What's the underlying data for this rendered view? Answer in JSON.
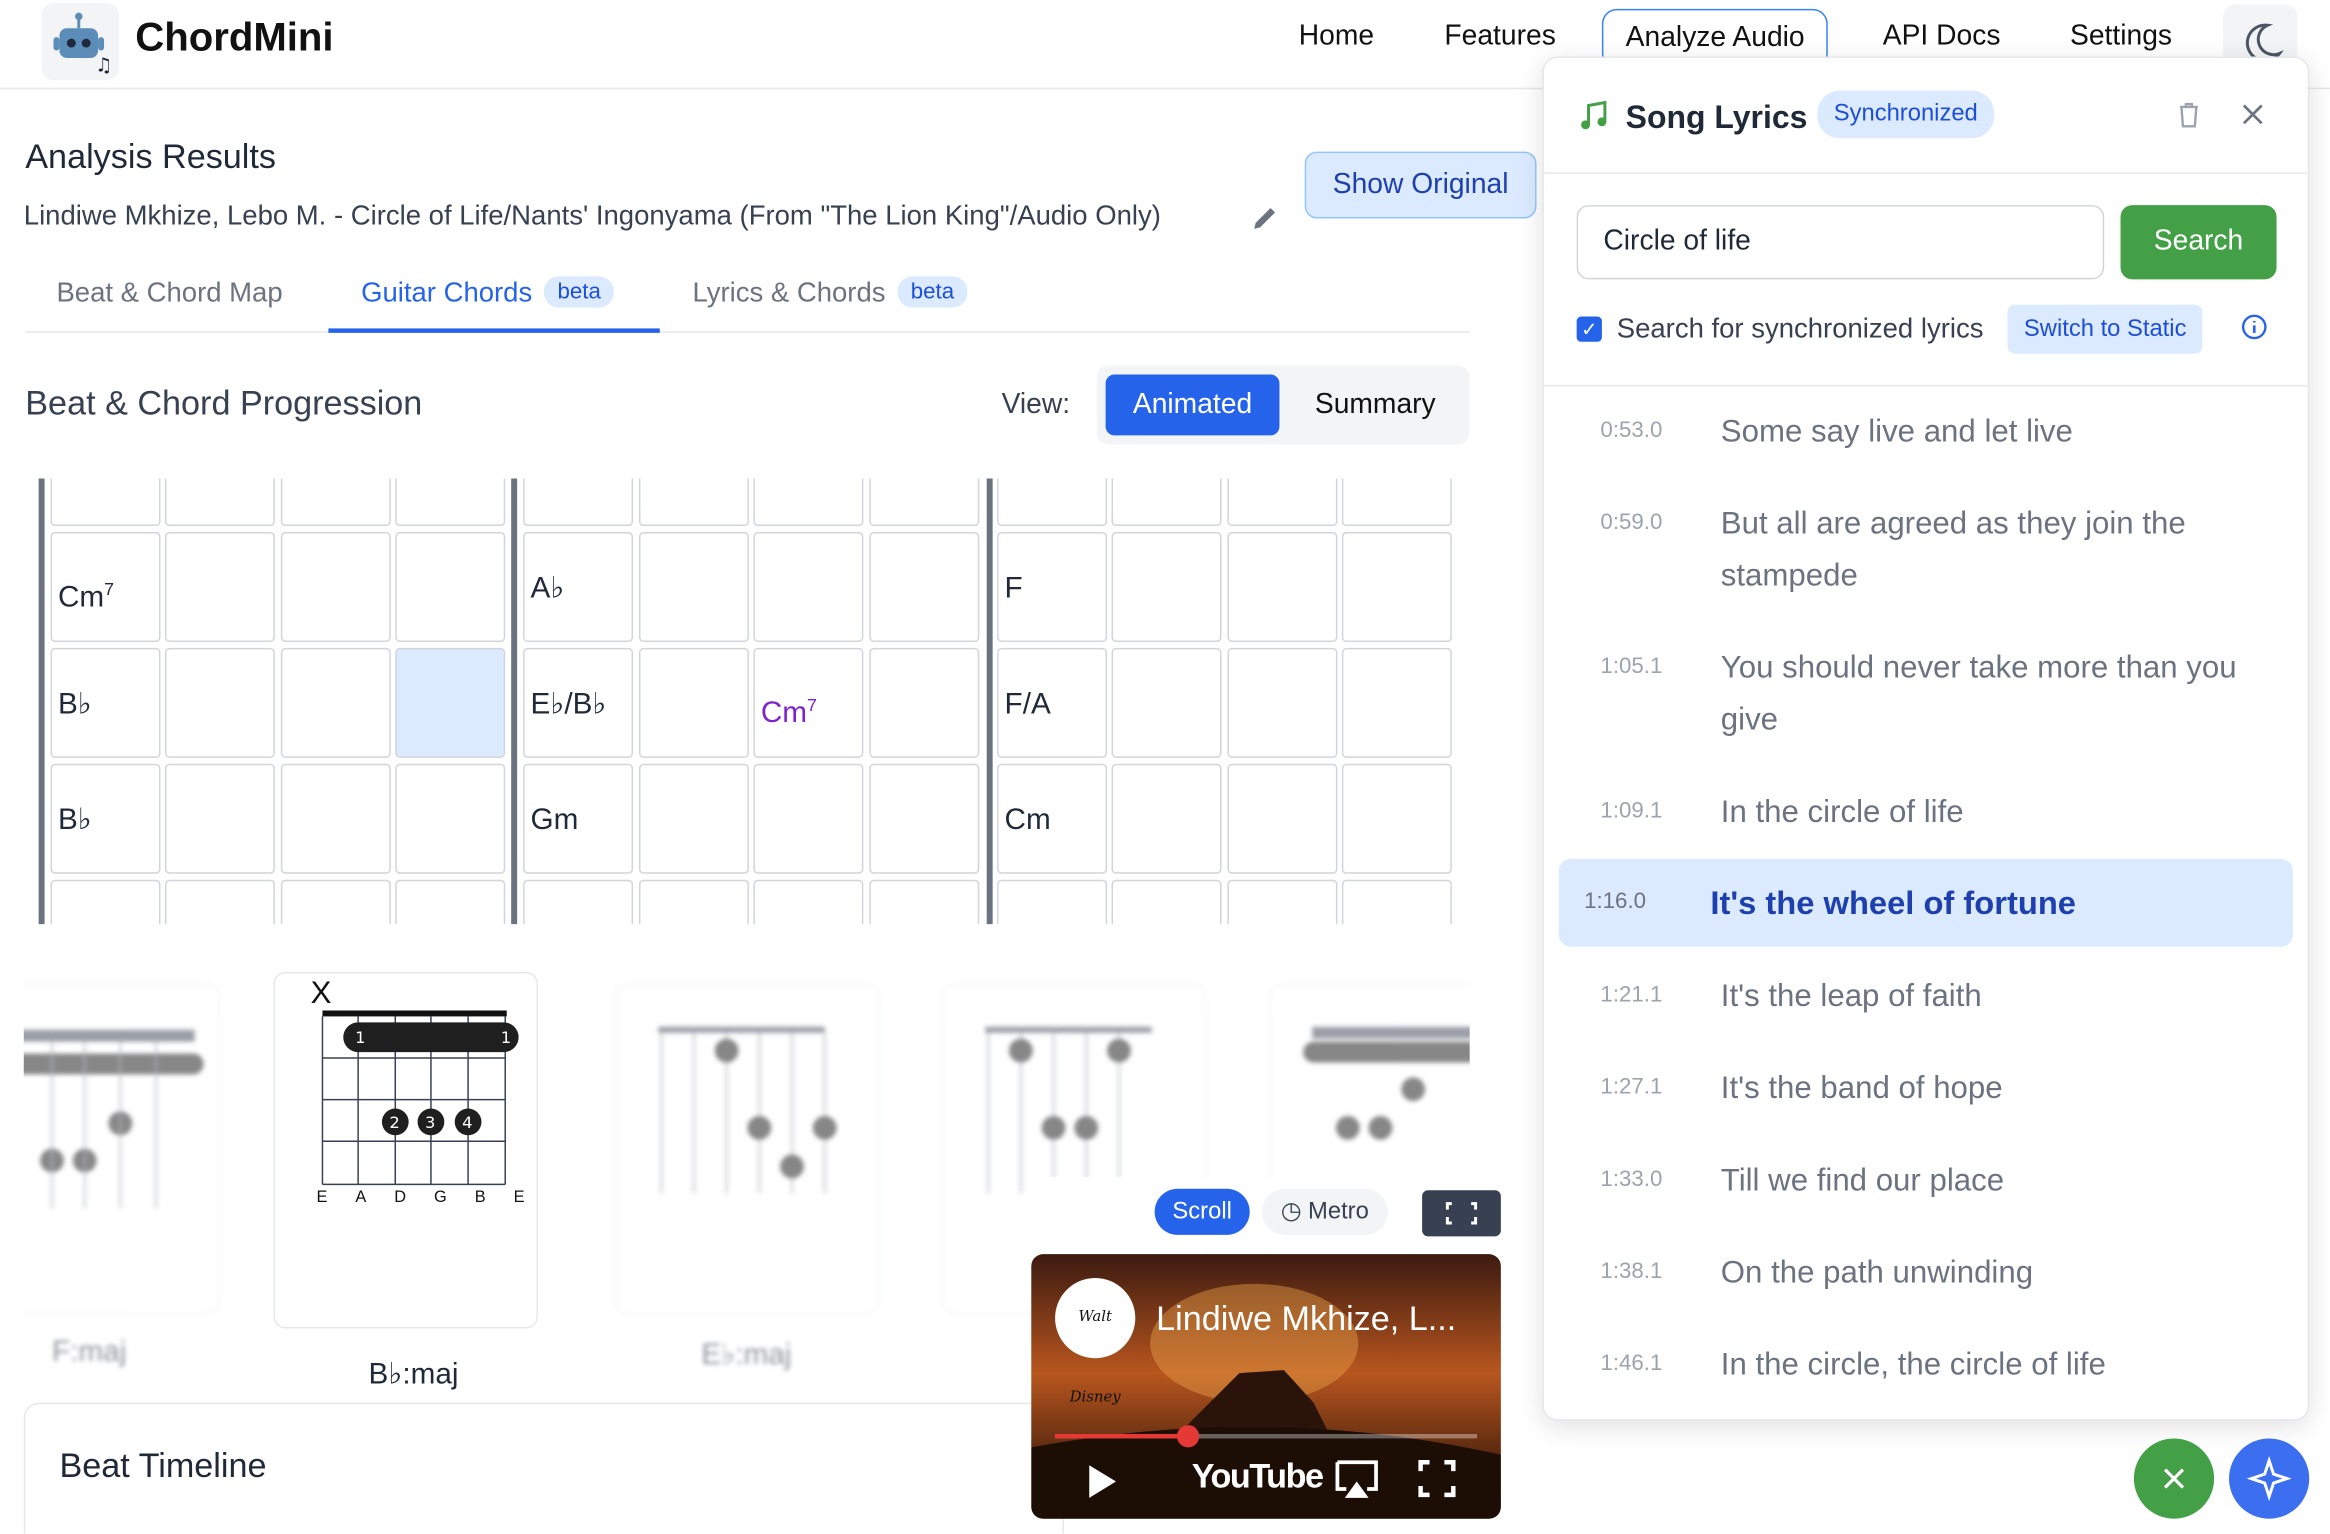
{
  "nav": {
    "brand": "ChordMini",
    "items": [
      "Home",
      "Features",
      "Analyze Audio",
      "API Docs",
      "Settings"
    ]
  },
  "results": {
    "heading": "Analysis Results",
    "song_title": "Lindiwe Mkhize, Lebo M. - Circle of Life/Nants' Ingonyama (From \"The Lion King\"/Audio Only)",
    "show_original": "Show Original"
  },
  "tabs": [
    {
      "label": "Beat & Chord Map",
      "badge": ""
    },
    {
      "label": "Guitar Chords",
      "badge": "beta"
    },
    {
      "label": "Lyrics & Chords",
      "badge": "beta"
    }
  ],
  "progression": {
    "heading": "Beat & Chord Progression",
    "view_label": "View:",
    "view_animated": "Animated",
    "view_summary": "Summary",
    "rows": [
      [
        "Cm7",
        "",
        "",
        "",
        "A♭",
        "",
        "",
        "",
        "F",
        "",
        "",
        ""
      ],
      [
        "B♭",
        "",
        "",
        "",
        "E♭/B♭",
        "",
        "Cm7",
        "",
        "F/A",
        "",
        "",
        ""
      ],
      [
        "B♭",
        "",
        "",
        "",
        "Gm",
        "",
        "",
        "",
        "Cm",
        "",
        "",
        ""
      ]
    ]
  },
  "diagrams": {
    "labels": [
      "F:maj",
      "B♭:maj",
      "E♭:maj"
    ],
    "strings": [
      "E",
      "A",
      "D",
      "G",
      "B",
      "E"
    ],
    "mute": "X"
  },
  "timeline": {
    "title": "Beat Timeline"
  },
  "player": {
    "scroll": "Scroll",
    "metro": "Metro",
    "video_title": "Lindiwe Mkhize, L...",
    "channel_logo": "Walt Disney",
    "youtube": "YouTube"
  },
  "lyrics": {
    "title": "Song Lyrics",
    "badge": "Synchronized",
    "search_value": "Circle of life",
    "search_button": "Search",
    "checkbox_label": "Search for synchronized lyrics",
    "switch_label": "Switch to Static",
    "active_index": 4,
    "lines": [
      {
        "time": "0:53.0",
        "text": "Some say live and let live"
      },
      {
        "time": "0:59.0",
        "text": "But all are agreed as they join the stampede"
      },
      {
        "time": "1:05.1",
        "text": "You should never take more than you give"
      },
      {
        "time": "1:09.1",
        "text": "In the circle of life"
      },
      {
        "time": "1:16.0",
        "text": "It's the wheel of fortune"
      },
      {
        "time": "1:21.1",
        "text": "It's the leap of faith"
      },
      {
        "time": "1:27.1",
        "text": "It's the band of hope"
      },
      {
        "time": "1:33.0",
        "text": "Till we find our place"
      },
      {
        "time": "1:38.1",
        "text": "On the path unwinding"
      },
      {
        "time": "1:46.1",
        "text": "In the circle, the circle of life"
      }
    ]
  },
  "colors": {
    "accent": "#2563eb",
    "search_green": "#43a047",
    "active_bg": "#dbeafe"
  }
}
